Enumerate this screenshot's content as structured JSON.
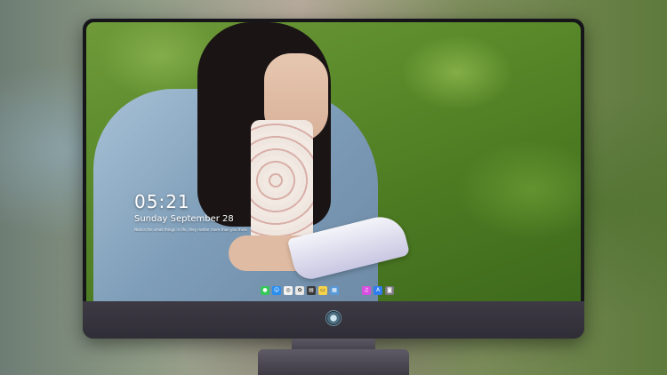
{
  "lock_screen": {
    "time": "05:21",
    "date": "Sunday September 28",
    "quote": "Notice the small things in life, they matter more than you think"
  },
  "dock": {
    "left_apps": [
      {
        "name": "messages-icon",
        "glyph": "●",
        "color": "#35c759"
      },
      {
        "name": "finder-icon",
        "glyph": "☺",
        "color": "#2a8ef0"
      },
      {
        "name": "safari-icon",
        "glyph": "◎",
        "color": "#f2f2f2"
      },
      {
        "name": "photos-icon",
        "glyph": "✿",
        "color": "#e8e8e8"
      },
      {
        "name": "clapperboard-icon",
        "glyph": "▤",
        "color": "#3a3a3a"
      },
      {
        "name": "notes-icon",
        "glyph": "▭",
        "color": "#f7d34c"
      },
      {
        "name": "preview-icon",
        "glyph": "▦",
        "color": "#5a9ad8"
      }
    ],
    "right_apps": [
      {
        "name": "music-icon",
        "glyph": "♫",
        "color": "#d94fe0"
      },
      {
        "name": "app-store-icon",
        "glyph": "A",
        "color": "#2f7df0"
      },
      {
        "name": "camera-icon",
        "glyph": "◙",
        "color": "#7a7a80"
      }
    ]
  },
  "colors": {
    "monitor_body": "#15151a",
    "chin": "#3d3a44",
    "stand": "#5a5662"
  }
}
